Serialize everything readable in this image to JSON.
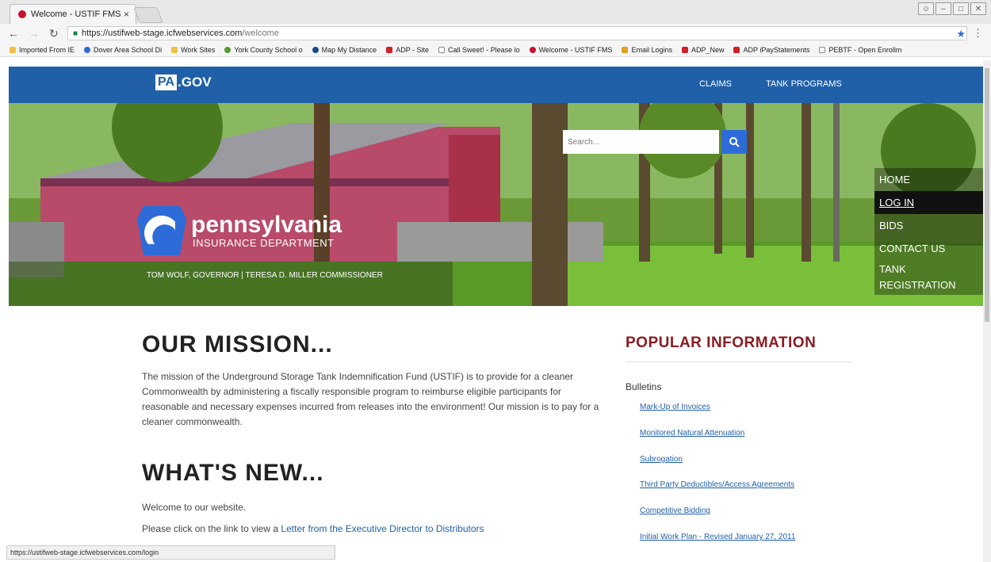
{
  "browser": {
    "tab_title": "Welcome - USTIF FMS",
    "tab_close": "×",
    "url_host": "https://ustifweb-stage.icfwebservices.com",
    "url_path": "/welcome",
    "status_url": "https://ustifweb-stage.icfwebservices.com/login",
    "bookmarks": [
      "Imported From IE",
      "Dover Area School Di",
      "Work Sites",
      "York County School o",
      "Map My Distance",
      "ADP - Site",
      "Call Sweet! - Please lo",
      "Welcome - USTIF FMS",
      "Email Logins",
      "ADP_New",
      "ADP iPayStatements",
      "PEBTF - Open Enrollm"
    ]
  },
  "topnav": {
    "logo_pa": "PA",
    "logo_gov": ".GOV",
    "claims": "CLAIMS",
    "tank_programs": "TANK PROGRAMS"
  },
  "hero": {
    "search_placeholder": "Search...",
    "brand_name": "pennsylvania",
    "brand_dept": "INSURANCE DEPARTMENT",
    "gov_line": "TOM WOLF, GOVERNOR  |  TERESA D. MILLER COMMISSIONER",
    "menu": {
      "home": "HOME",
      "login": "LOG IN",
      "bids": "BIDS",
      "contact": "CONTACT US",
      "tank_reg": "TANK REGISTRATION"
    }
  },
  "mission": {
    "heading": "OUR MISSION...",
    "body": "The mission of the Underground Storage Tank Indemnification Fund (USTIF) is to provide for a cleaner Commonwealth by administering a fiscally responsible program to reimburse eligible participants for reasonable and necessary expenses incurred from releases into the environment!  Our mission is to pay for a cleaner commonwealth."
  },
  "whats_new": {
    "heading": "WHAT'S NEW...",
    "welcome": "Welcome to our website.",
    "prefix": "Please click on the link to view a ",
    "link": "Letter from the Executive Director to Distributors"
  },
  "popular": {
    "heading": "POPULAR INFORMATION",
    "bulletins": "Bulletins",
    "links": [
      "Mark-Up of Invoices",
      "Monitored Natural Attenuation",
      "Subrogation",
      "Third Party Deductibles/Access Agreements",
      "Competitive Bidding",
      "Initial Work Plan - Revised January 27, 2011"
    ]
  }
}
